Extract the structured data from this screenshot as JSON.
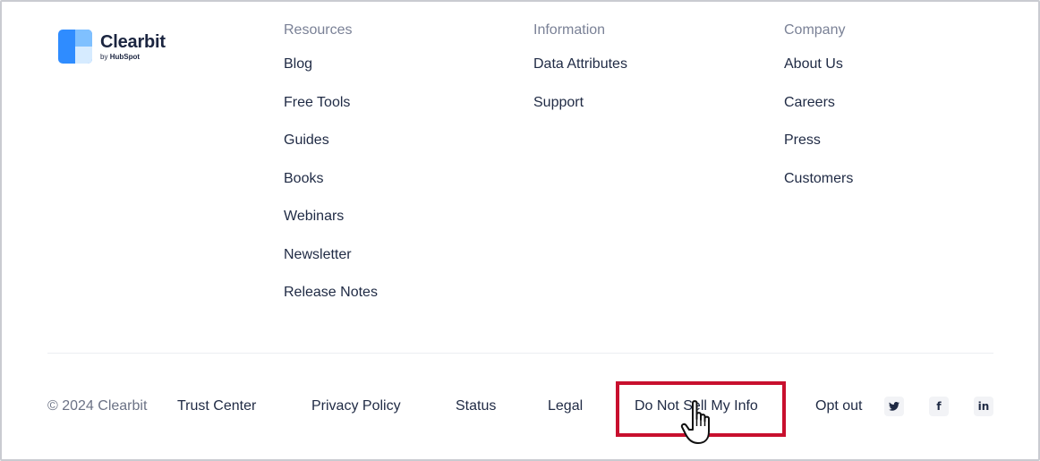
{
  "brand": {
    "name": "Clearbit",
    "byline_prefix": "by",
    "byline_company": "HubSpot"
  },
  "columns": [
    {
      "heading": "Resources",
      "links": [
        "Blog",
        "Free Tools",
        "Guides",
        "Books",
        "Webinars",
        "Newsletter",
        "Release Notes"
      ]
    },
    {
      "heading": "Information",
      "links": [
        "Data Attributes",
        "Support"
      ]
    },
    {
      "heading": "Company",
      "links": [
        "About Us",
        "Careers",
        "Press",
        "Customers"
      ]
    }
  ],
  "footer": {
    "copyright": "© 2024 Clearbit",
    "links": [
      "Trust Center",
      "Privacy Policy",
      "Status",
      "Legal",
      "Do Not Sell My Info",
      "Opt out"
    ],
    "social": [
      {
        "icon": "twitter-icon",
        "glyph": "🐦"
      },
      {
        "icon": "facebook-icon",
        "glyph": "f"
      },
      {
        "icon": "linkedin-icon",
        "glyph": "in"
      }
    ]
  },
  "colors": {
    "highlight": "#c8102e",
    "brand_blue": "#2f8cff"
  }
}
